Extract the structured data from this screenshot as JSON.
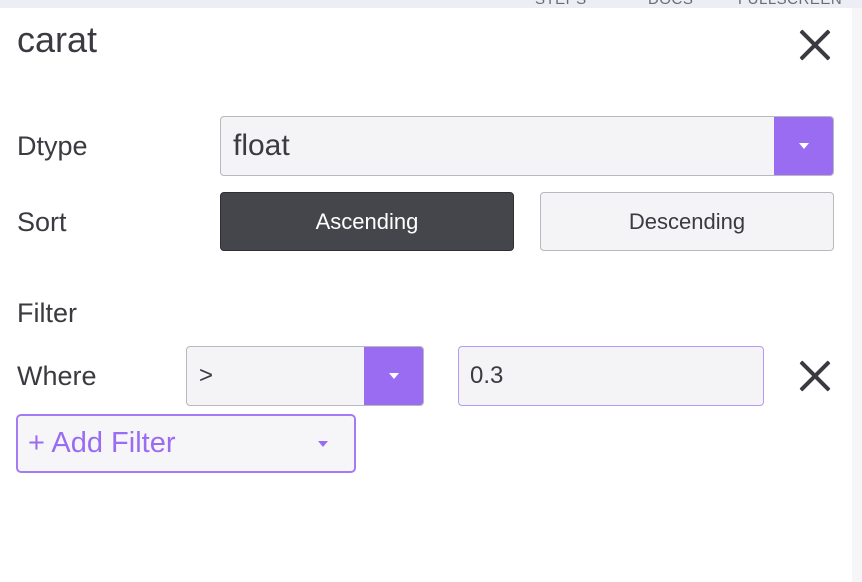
{
  "topbar": {
    "items": [
      "STEPS",
      "DOCS",
      "FULLSCREEN"
    ]
  },
  "panel": {
    "title": "carat"
  },
  "dtype": {
    "label": "Dtype",
    "value": "float"
  },
  "sort": {
    "label": "Sort",
    "ascending": "Ascending",
    "descending": "Descending",
    "selected": "Ascending"
  },
  "filter": {
    "heading": "Filter",
    "where_label": "Where",
    "operator": ">",
    "value": "0.3",
    "add_label": "+ Add Filter"
  },
  "colors": {
    "accent": "#9a6cf2",
    "active_button": "#45454c",
    "text": "#3a3a40"
  }
}
